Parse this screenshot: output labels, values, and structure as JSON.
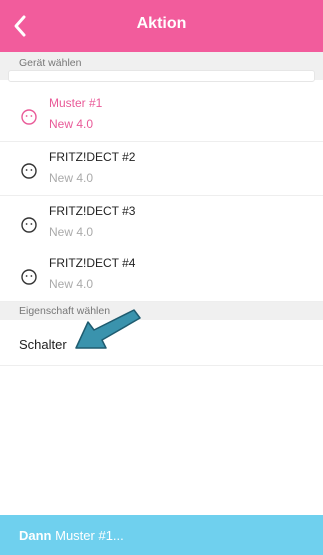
{
  "header": {
    "title": "Aktion",
    "back_icon": "chevron-left-icon"
  },
  "section_device": {
    "label": "Gerät wählen"
  },
  "devices": [
    {
      "name": "Muster #1",
      "version": "New 4.0",
      "selected": true
    },
    {
      "name": "FRITZ!DECT #2",
      "version": "New 4.0",
      "selected": false
    },
    {
      "name": "FRITZ!DECT #3",
      "version": "New 4.0",
      "selected": false
    },
    {
      "name": "FRITZ!DECT #4",
      "version": "New 4.0",
      "selected": false
    }
  ],
  "section_property": {
    "label": "Eigenschaft wählen"
  },
  "property": {
    "label": "Schalter"
  },
  "footer": {
    "prefix": "Dann",
    "text": "Muster #1..."
  },
  "colors": {
    "header": "#f25c9c",
    "selected": "#e95a98",
    "footer": "#6fd0ee",
    "arrow": "#3a93ad"
  }
}
